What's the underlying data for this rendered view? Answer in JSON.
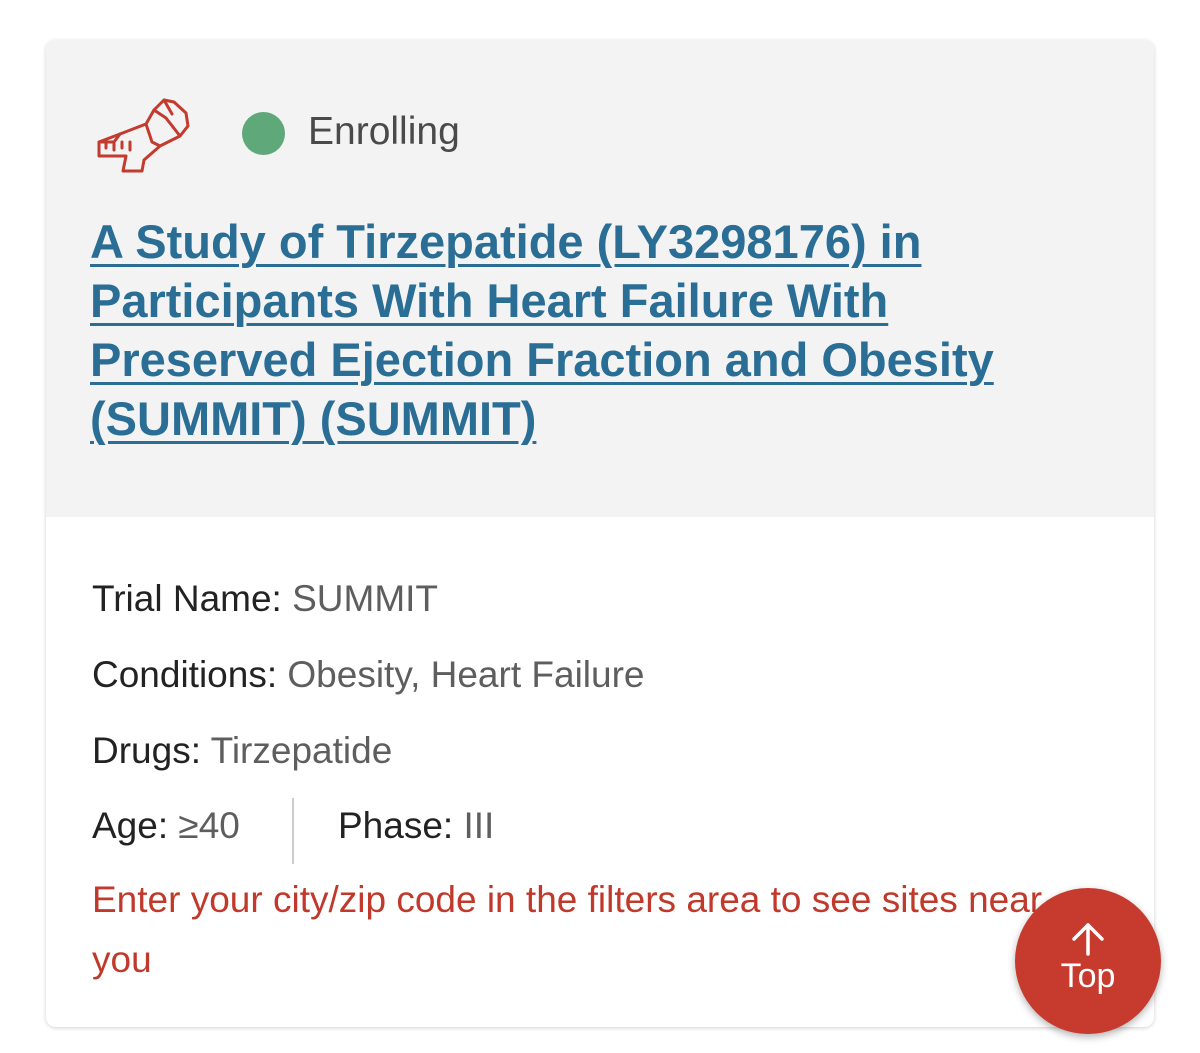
{
  "trial": {
    "status": "Enrolling",
    "status_color": "#5fa87a",
    "category_icon": "measuring-tape-icon",
    "title": "A Study of Tirzepatide (LY3298176) in Participants With Heart Failure With Preserved Ejection Fraction and Obesity (SUMMIT) (SUMMIT)",
    "title_color": "#2a6d95"
  },
  "details": {
    "trial_name_label": "Trial Name:",
    "trial_name_value": "SUMMIT",
    "conditions_label": "Conditions:",
    "conditions_value": "Obesity, Heart Failure",
    "drugs_label": "Drugs:",
    "drugs_value": "Tirzepatide",
    "age_label": "Age:",
    "age_value": "≥40",
    "phase_label": "Phase:",
    "phase_value": "III"
  },
  "notice": {
    "text": "Enter your city/zip code in the filters area to see sites near you",
    "color": "#c0392b"
  },
  "scroll_top": {
    "label": "Top",
    "icon": "arrow-up-icon",
    "color": "#c73a2e"
  }
}
